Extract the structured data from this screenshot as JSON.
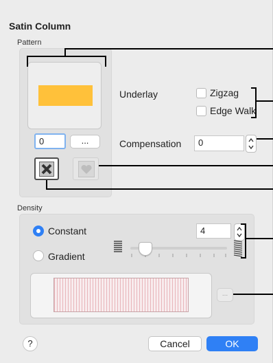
{
  "dialog": {
    "title": "Satin Column",
    "pattern": {
      "section_label": "Pattern",
      "swatch_color": "#ffc13a",
      "number_value": "0",
      "more_label": "..."
    },
    "underlay": {
      "label": "Underlay",
      "zigzag_label": "Zigzag",
      "edge_walk_label": "Edge Walk",
      "zigzag_checked": false,
      "edge_walk_checked": false
    },
    "compensation": {
      "label": "Compensation",
      "value": "0"
    },
    "density": {
      "section_label": "Density",
      "constant_label": "Constant",
      "gradient_label": "Gradient",
      "selected": "Constant",
      "value": "4",
      "slider_level": 0.12,
      "preview_more_label": "..."
    },
    "buttons": {
      "help": "?",
      "cancel": "Cancel",
      "ok": "OK"
    },
    "colors": {
      "accent": "#2f80f5",
      "stripe": "#e8b4b9",
      "preview_bg": "#f8ecee"
    }
  }
}
